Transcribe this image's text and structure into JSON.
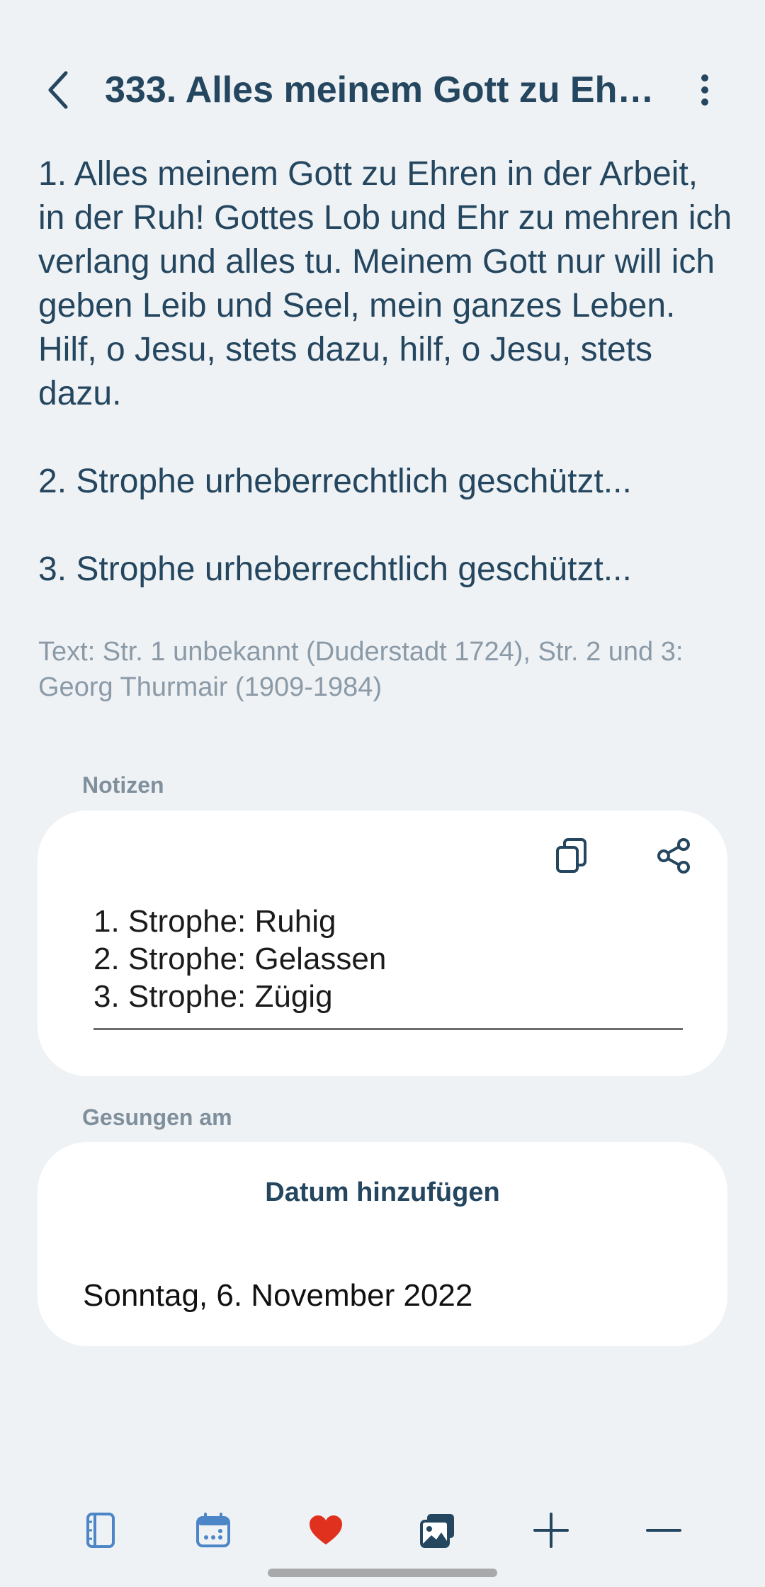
{
  "header": {
    "title": "333. Alles meinem Gott zu Ehren",
    "back_icon": "back-chevron-icon",
    "menu_icon": "more-vertical-icon"
  },
  "lyrics": {
    "verses": [
      "1. Alles meinem Gott zu Ehren in der Arbeit, in der Ruh! Gottes Lob und Ehr zu mehren ich verlang und alles tu. Meinem Gott nur will ich geben Leib und Seel, mein ganzes Leben. Hilf, o Jesu, stets dazu, hilf, o Jesu, stets dazu.",
      "2. Strophe urheberrechtlich geschützt...",
      "3. Strophe urheberrechtlich geschützt..."
    ],
    "source": "Text: Str. 1 unbekannt (Duderstadt 1724), Str. 2 und 3: Georg Thurmair (1909-1984)"
  },
  "notes": {
    "label": "Notizen",
    "text": "1. Strophe: Ruhig\n2. Strophe: Gelassen\n3. Strophe: Zügig",
    "copy_icon": "copy-icon",
    "share_icon": "share-icon"
  },
  "sung": {
    "label": "Gesungen am",
    "add_date_label": "Datum hinzufügen",
    "dates": [
      "Sonntag, 6. November 2022"
    ]
  },
  "bottom_nav": {
    "items": [
      "book-icon",
      "calendar-icon",
      "heart-icon",
      "gallery-icon",
      "plus-icon",
      "minus-icon"
    ]
  },
  "colors": {
    "background": "#eff2f5",
    "primary_text": "#24465f",
    "muted_text": "#8a9aa7",
    "accent_blue": "#4d86c6",
    "heart_red": "#e0301e",
    "card": "#ffffff"
  }
}
